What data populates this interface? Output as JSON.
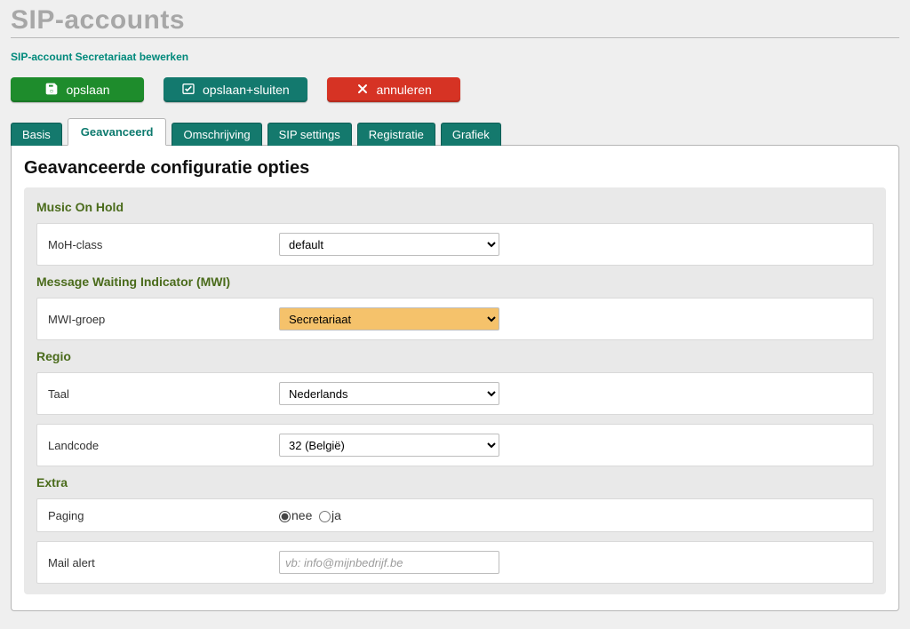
{
  "pageTitle": "SIP-accounts",
  "breadcrumb": "SIP-account Secretariaat bewerken",
  "actions": {
    "save": "opslaan",
    "saveClose": "opslaan+sluiten",
    "cancel": "annuleren"
  },
  "tabs": {
    "basis": "Basis",
    "advanced": "Geavanceerd",
    "description": "Omschrijving",
    "sipSettings": "SIP settings",
    "registration": "Registratie",
    "chart": "Grafiek"
  },
  "panelTitle": "Geavanceerde configuratie opties",
  "sections": {
    "moh": {
      "title": "Music On Hold",
      "mohClassLabel": "MoH-class",
      "mohClassValue": "default"
    },
    "mwi": {
      "title": "Message Waiting Indicator (MWI)",
      "groupLabel": "MWI-groep",
      "groupValue": "Secretariaat"
    },
    "regio": {
      "title": "Regio",
      "langLabel": "Taal",
      "langValue": "Nederlands",
      "countryLabel": "Landcode",
      "countryValue": "32 (België)"
    },
    "extra": {
      "title": "Extra",
      "pagingLabel": "Paging",
      "pagingNo": "nee",
      "pagingYes": "ja",
      "mailLabel": "Mail alert",
      "mailPlaceholder": "vb: info@mijnbedrijf.be"
    }
  }
}
